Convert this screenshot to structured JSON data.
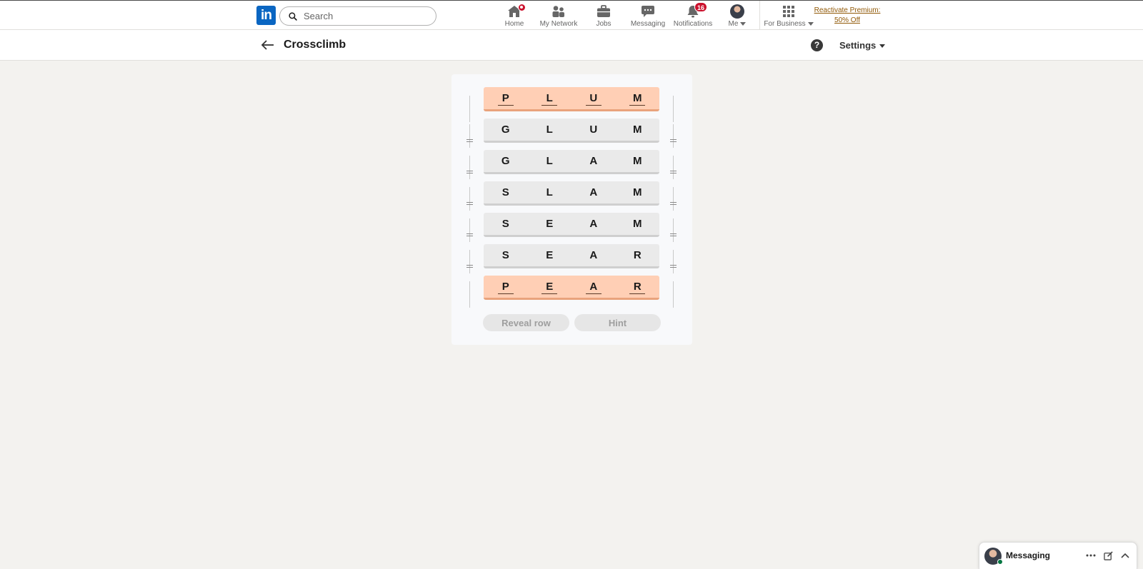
{
  "nav": {
    "logo": "in",
    "search_placeholder": "Search",
    "items": [
      {
        "label": "Home",
        "icon": "home-icon"
      },
      {
        "label": "My Network",
        "icon": "people-icon"
      },
      {
        "label": "Jobs",
        "icon": "briefcase-icon"
      },
      {
        "label": "Messaging",
        "icon": "chat-icon"
      },
      {
        "label": "Notifications",
        "icon": "bell-icon",
        "badge": "16"
      },
      {
        "label": "Me",
        "icon": "avatar"
      }
    ],
    "for_business": "For Business",
    "premium_line1": "Reactivate Premium:",
    "premium_line2": "50% Off"
  },
  "header": {
    "title": "Crossclimb",
    "settings_label": "Settings"
  },
  "board": {
    "rows": [
      {
        "letters": [
          "P",
          "L",
          "U",
          "M"
        ],
        "fixed": true
      },
      {
        "letters": [
          "G",
          "L",
          "U",
          "M"
        ],
        "fixed": false
      },
      {
        "letters": [
          "G",
          "L",
          "A",
          "M"
        ],
        "fixed": false
      },
      {
        "letters": [
          "S",
          "L",
          "A",
          "M"
        ],
        "fixed": false
      },
      {
        "letters": [
          "S",
          "E",
          "A",
          "M"
        ],
        "fixed": false
      },
      {
        "letters": [
          "S",
          "E",
          "A",
          "R"
        ],
        "fixed": false
      },
      {
        "letters": [
          "P",
          "E",
          "A",
          "R"
        ],
        "fixed": true
      }
    ]
  },
  "actions": {
    "reveal_label": "Reveal row",
    "hint_label": "Hint"
  },
  "dock": {
    "label": "Messaging"
  },
  "colors": {
    "brand": "#0a66c2",
    "fixed_row": "#ffcfb5",
    "row": "#eaeaea",
    "badge": "#cb112d",
    "premium_link": "#915907"
  }
}
